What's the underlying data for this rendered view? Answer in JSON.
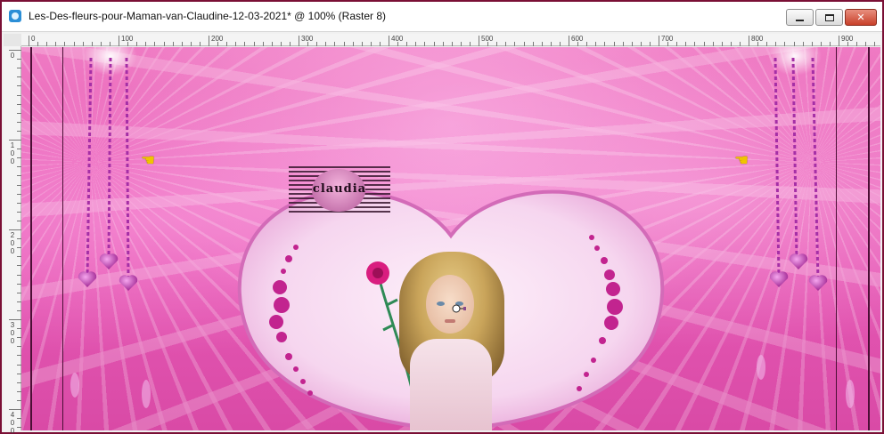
{
  "window": {
    "title": "Les-Des-fleurs-pour-Maman-van-Claudine-12-03-2021* @ 100% (Raster 8)",
    "minimize_label": "",
    "maximize_label": "",
    "close_label": "✕"
  },
  "ruler_top": [
    "0",
    "100",
    "200",
    "300",
    "400",
    "500",
    "600",
    "700",
    "800",
    "900"
  ],
  "ruler_left": [
    "0",
    "100",
    "200",
    "300",
    "400"
  ],
  "canvas": {
    "watermark_text": "claudia",
    "pointer_glyph": "☚",
    "colors": {
      "background_pink": "#e659b5",
      "heart_fill": "#f6d6ef",
      "heart_rim": "#d36bb8",
      "rose_magenta": "#c2248f",
      "chain_purple": "#a52fa6",
      "frame_dark": "#4b0f35",
      "pointer_yellow": "#f0c400"
    }
  }
}
